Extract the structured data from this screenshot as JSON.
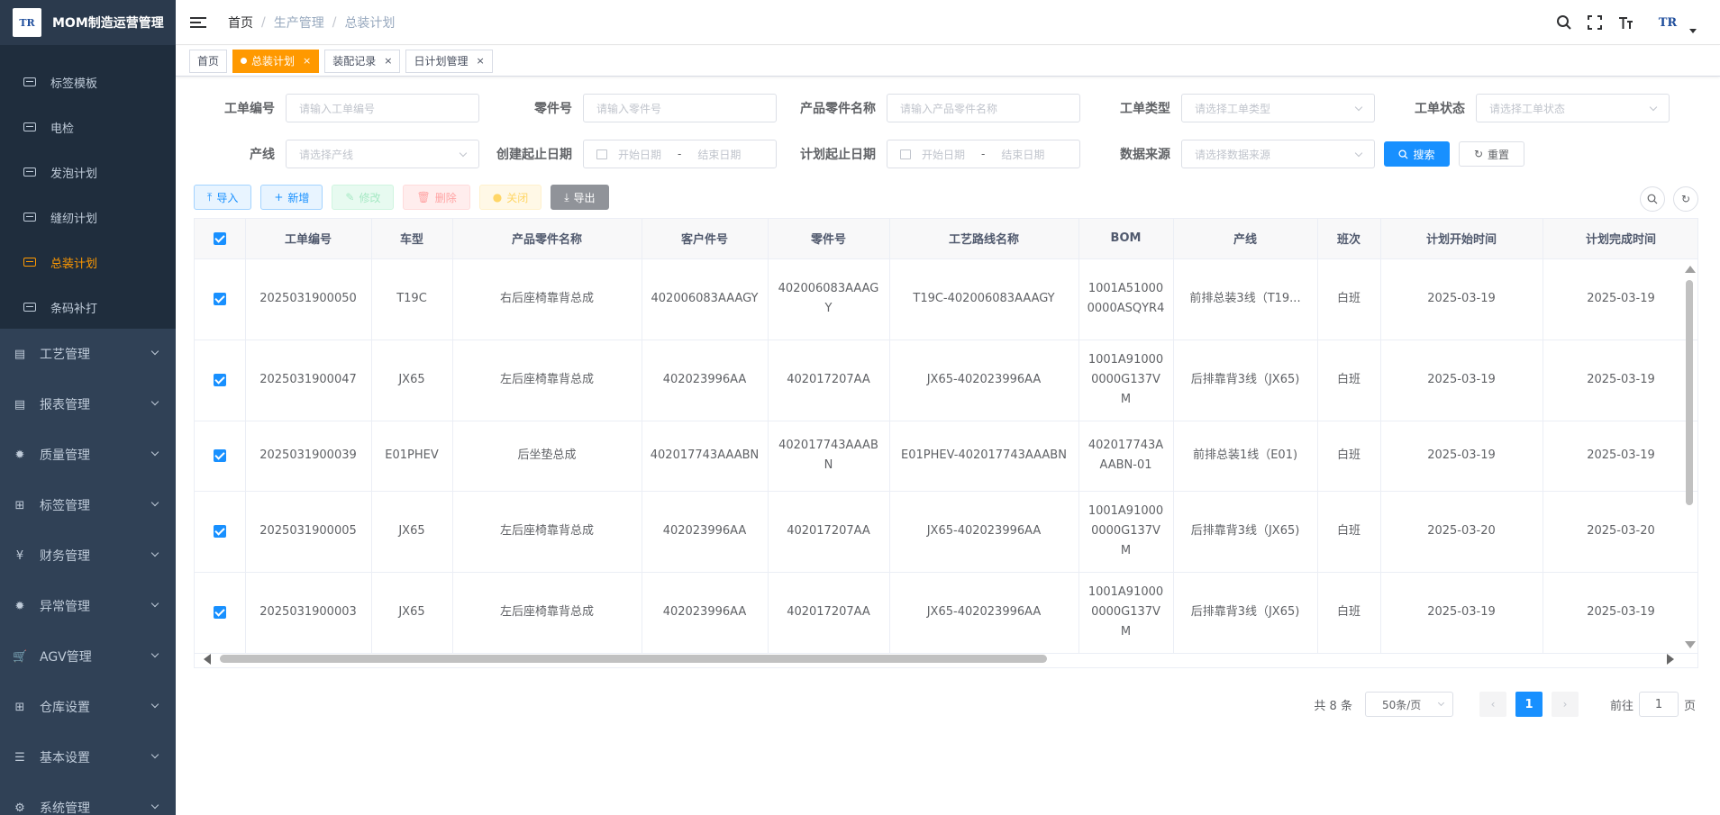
{
  "app": {
    "title": "MOM制造运营管理",
    "logo_text": "TR"
  },
  "sidebar": {
    "sub_items": [
      {
        "label": "标签模板",
        "active": false
      },
      {
        "label": "电检",
        "active": false
      },
      {
        "label": "发泡计划",
        "active": false
      },
      {
        "label": "缝纫计划",
        "active": false
      },
      {
        "label": "总装计划",
        "active": true
      },
      {
        "label": "条码补打",
        "active": false
      }
    ],
    "menus": [
      {
        "label": "工艺管理",
        "icon": "document-icon",
        "glyph": "▤"
      },
      {
        "label": "报表管理",
        "icon": "report-icon",
        "glyph": "▤"
      },
      {
        "label": "质量管理",
        "icon": "bug-icon",
        "glyph": "✹"
      },
      {
        "label": "标签管理",
        "icon": "grid-icon",
        "glyph": "⊞"
      },
      {
        "label": "财务管理",
        "icon": "yen-icon",
        "glyph": "¥"
      },
      {
        "label": "异常管理",
        "icon": "bug-icon",
        "glyph": "✹"
      },
      {
        "label": "AGV管理",
        "icon": "cart-icon",
        "glyph": "🛒"
      },
      {
        "label": "仓库设置",
        "icon": "grid-icon",
        "glyph": "⊞"
      },
      {
        "label": "基本设置",
        "icon": "sliders-icon",
        "glyph": "☰"
      },
      {
        "label": "系统管理",
        "icon": "gear-icon",
        "glyph": "⚙"
      }
    ]
  },
  "breadcrumb": [
    "首页",
    "生产管理",
    "总装计划"
  ],
  "tabs": [
    {
      "label": "首页",
      "active": false,
      "closable": false
    },
    {
      "label": "总装计划",
      "active": true,
      "closable": true
    },
    {
      "label": "装配记录",
      "active": false,
      "closable": true
    },
    {
      "label": "日计划管理",
      "active": false,
      "closable": true
    }
  ],
  "filters": {
    "order_no": {
      "label": "工单编号",
      "placeholder": "请输入工单编号"
    },
    "part_no": {
      "label": "零件号",
      "placeholder": "请输入零件号"
    },
    "product_name": {
      "label": "产品零件名称",
      "placeholder": "请输入产品零件名称"
    },
    "order_type": {
      "label": "工单类型",
      "placeholder": "请选择工单类型"
    },
    "order_status": {
      "label": "工单状态",
      "placeholder": "请选择工单状态"
    },
    "line": {
      "label": "产线",
      "placeholder": "请选择产线"
    },
    "create_date": {
      "label": "创建起止日期",
      "start": "开始日期",
      "end": "结束日期",
      "sep": "-"
    },
    "plan_date": {
      "label": "计划起止日期",
      "start": "开始日期",
      "end": "结束日期",
      "sep": "-"
    },
    "source": {
      "label": "数据来源",
      "placeholder": "请选择数据来源"
    },
    "search_label": "搜索",
    "reset_label": "重置"
  },
  "toolbar": {
    "import": "导入",
    "add": "新增",
    "edit": "修改",
    "delete": "删除",
    "close": "关闭",
    "export": "导出"
  },
  "table": {
    "columns": [
      "工单编号",
      "车型",
      "产品零件名称",
      "客户件号",
      "零件号",
      "工艺路线名称",
      "BOM",
      "产线",
      "班次",
      "计划开始时间",
      "计划完成时间"
    ],
    "rows": [
      [
        "2025031900050",
        "T19C",
        "右后座椅靠背总成",
        "402006083AAAGY",
        "402006083AAAGY",
        "T19C-402006083AAAGY",
        "1001A510000000ASQYR4",
        "前排总装3线（T19...",
        "白班",
        "2025-03-19",
        "2025-03-19"
      ],
      [
        "2025031900047",
        "JX65",
        "左后座椅靠背总成",
        "402023996AA",
        "402017207AA",
        "JX65-402023996AA",
        "1001A910000000G137VM",
        "后排靠背3线（JX65)",
        "白班",
        "2025-03-19",
        "2025-03-19"
      ],
      [
        "2025031900039",
        "E01PHEV",
        "后坐垫总成",
        "402017743AAABN",
        "402017743AAABN",
        "E01PHEV-402017743AAABN",
        "402017743AAABN-01",
        "前排总装1线（E01)",
        "白班",
        "2025-03-19",
        "2025-03-19"
      ],
      [
        "2025031900005",
        "JX65",
        "左后座椅靠背总成",
        "402023996AA",
        "402017207AA",
        "JX65-402023996AA",
        "1001A910000000G137VM",
        "后排靠背3线（JX65)",
        "白班",
        "2025-03-20",
        "2025-03-20"
      ],
      [
        "2025031900003",
        "JX65",
        "左后座椅靠背总成",
        "402023996AA",
        "402017207AA",
        "JX65-402023996AA",
        "1001A910000000G137VM",
        "后排靠背3线（JX65)",
        "白班",
        "2025-03-19",
        "2025-03-19"
      ]
    ]
  },
  "pagination": {
    "total": "共 8 条",
    "page_size": "50条/页",
    "current": "1",
    "goto_prefix": "前往",
    "goto_value": "1",
    "goto_suffix": "页"
  },
  "colors": {
    "sidebar_bg": "#304156",
    "submenu_bg": "#1f2d3d",
    "accent": "#ff9900",
    "primary": "#1890ff"
  }
}
